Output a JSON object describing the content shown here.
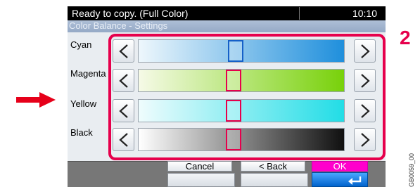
{
  "status": {
    "message": "Ready to copy. (Full Color)",
    "time": "10:10"
  },
  "screen": {
    "title": "Color Balance - Settings"
  },
  "rows": [
    {
      "label": "Cyan",
      "level": 0.47,
      "colors": [
        "#eef7fc",
        "#1f8fdc"
      ],
      "marker_color": "#1560c8"
    },
    {
      "label": "Magenta",
      "level": 0.46,
      "colors": [
        "#f6fae7",
        "#78d10a"
      ],
      "marker_color": "#e6004c"
    },
    {
      "label": "Yellow",
      "level": 0.46,
      "colors": [
        "#effcfd",
        "#22dde6"
      ],
      "marker_color": "#e6004c"
    },
    {
      "label": "Black",
      "level": 0.46,
      "colors": [
        "#ffffff",
        "#101010"
      ],
      "marker_color": "#e6004c"
    }
  ],
  "buttons": {
    "cancel": "Cancel",
    "back": "< Back",
    "ok": "OK"
  },
  "callout": {
    "number": "2",
    "color": "#e6004c"
  },
  "figure_code": "GB0059_00"
}
